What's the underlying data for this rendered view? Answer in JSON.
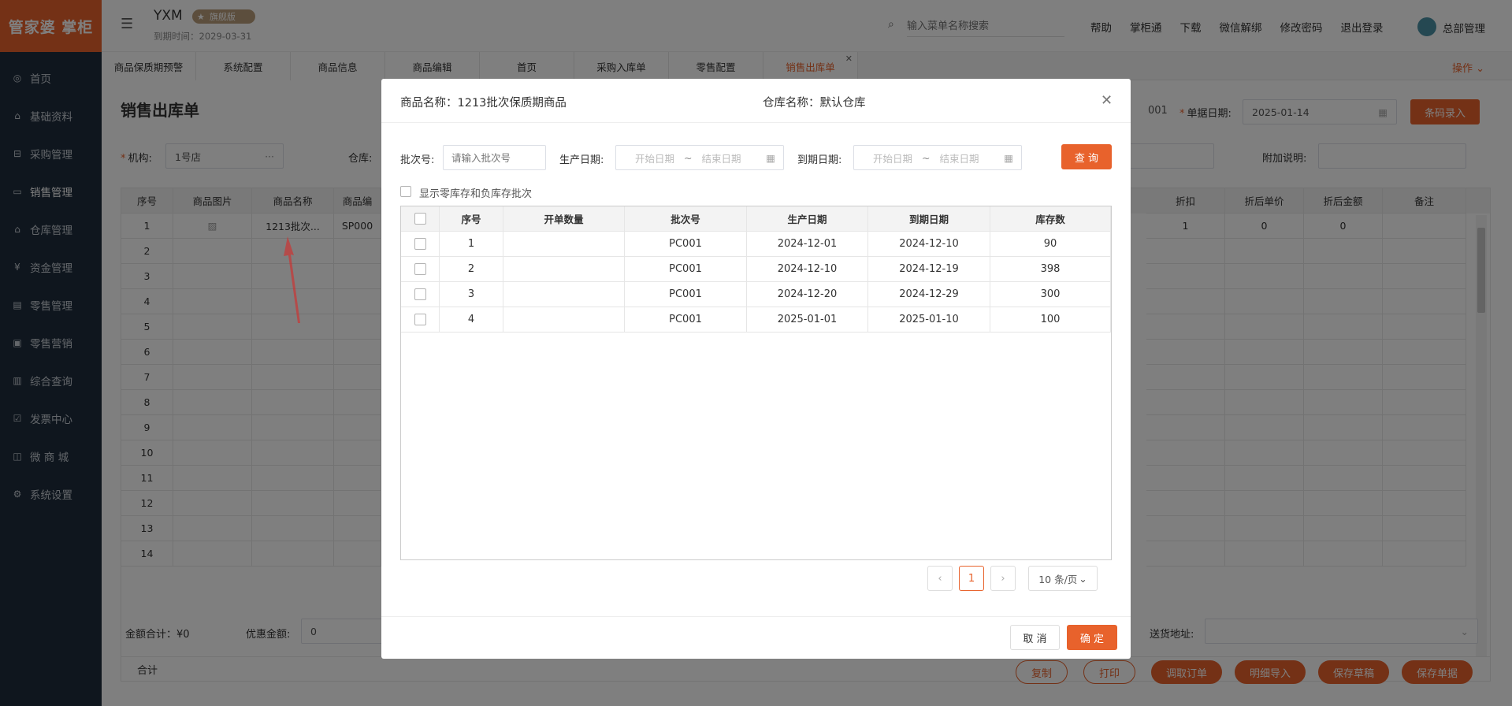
{
  "sidebar": {
    "logo": "管家婆 掌柜",
    "items": [
      {
        "label": "首页",
        "icon": "globe-icon",
        "glyph": "◎"
      },
      {
        "label": "基础资料",
        "icon": "home-icon",
        "glyph": "⌂"
      },
      {
        "label": "采购管理",
        "icon": "cart-icon",
        "glyph": "⊟"
      },
      {
        "label": "销售管理",
        "icon": "monitor-icon",
        "glyph": "▭"
      },
      {
        "label": "仓库管理",
        "icon": "warehouse-icon",
        "glyph": "⌂"
      },
      {
        "label": "资金管理",
        "icon": "money-icon",
        "glyph": "¥"
      },
      {
        "label": "零售管理",
        "icon": "chart-icon",
        "glyph": "▤"
      },
      {
        "label": "零售营销",
        "icon": "gift-icon",
        "glyph": "▣"
      },
      {
        "label": "综合查询",
        "icon": "bar-chart-icon",
        "glyph": "▥"
      },
      {
        "label": "发票中心",
        "icon": "invoice-icon",
        "glyph": "☑"
      },
      {
        "label": "微 商 城",
        "icon": "bag-icon",
        "glyph": "◫"
      },
      {
        "label": "系统设置",
        "icon": "gear-icon",
        "glyph": "⚙"
      }
    ]
  },
  "header": {
    "company": "YXM",
    "edition_badge": "旗舰版",
    "expiry": "到期时间：2029-03-31",
    "search_placeholder": "输入菜单名称搜索",
    "links": [
      "帮助",
      "掌柜通",
      "下载",
      "微信解绑",
      "修改密码",
      "退出登录"
    ],
    "user": "总部管理"
  },
  "tabs": [
    "商品保质期预警",
    "系统配置",
    "商品信息",
    "商品编辑",
    "首页",
    "采购入库单",
    "零售配置",
    "销售出库单"
  ],
  "tabs_action": "操作",
  "page": {
    "title": "销售出库单",
    "doc_no_tail": "001",
    "date_label": "单据日期",
    "date_value": "2025-01-14",
    "barcode_button": "条码录入",
    "org_label": "机构",
    "org_value": "1号店",
    "warehouse_label": "仓库",
    "note_label": "附加说明",
    "grid_headers": [
      "序号",
      "商品图片",
      "商品名称",
      "商品编"
    ],
    "grid_headers_right": [
      "折扣",
      "折后单价",
      "折后金额",
      "备注"
    ],
    "first_row": {
      "name": "1213批次...",
      "code": "SP000",
      "discount": "1",
      "disc_price": "0",
      "disc_amount": "0"
    },
    "row_numbers": [
      "1",
      "2",
      "3",
      "4",
      "5",
      "6",
      "7",
      "8",
      "9",
      "10",
      "11",
      "12",
      "13",
      "14"
    ],
    "total_label": "合计",
    "total_amount": "0",
    "amount_total": "金额合计：¥0",
    "discount_label": "优惠金额",
    "discount_value": "0",
    "address_label": "送货地址",
    "actions": [
      "复制",
      "打印",
      "调取订单",
      "明细导入",
      "保存草稿",
      "保存单据"
    ]
  },
  "modal": {
    "product_label": "商品名称：1213批次保质期商品",
    "warehouse_label": "仓库名称：默认仓库",
    "batch_label": "批次号",
    "batch_placeholder": "请输入批次号",
    "prod_date_label": "生产日期",
    "exp_date_label": "到期日期",
    "start_placeholder": "开始日期",
    "end_placeholder": "结束日期",
    "date_sep": "~",
    "query_button": "查 询",
    "show_zero_label": "显示零库存和负库存批次",
    "columns": [
      "序号",
      "开单数量",
      "批次号",
      "生产日期",
      "到期日期",
      "库存数"
    ],
    "rows": [
      {
        "no": "1",
        "qty": "",
        "batch": "PC001",
        "prod": "2024-12-01",
        "exp": "2024-12-10",
        "stock": "90"
      },
      {
        "no": "2",
        "qty": "",
        "batch": "PC001",
        "prod": "2024-12-10",
        "exp": "2024-12-19",
        "stock": "398"
      },
      {
        "no": "3",
        "qty": "",
        "batch": "PC001",
        "prod": "2024-12-20",
        "exp": "2024-12-29",
        "stock": "300"
      },
      {
        "no": "4",
        "qty": "",
        "batch": "PC001",
        "prod": "2025-01-01",
        "exp": "2025-01-10",
        "stock": "100"
      }
    ],
    "pagination": {
      "current": "1",
      "page_size": "10 条/页"
    },
    "cancel_button": "取 消",
    "confirm_button": "确 定"
  },
  "colors": {
    "accent": "#e8622c",
    "sidebar": "#1f2d3d"
  }
}
